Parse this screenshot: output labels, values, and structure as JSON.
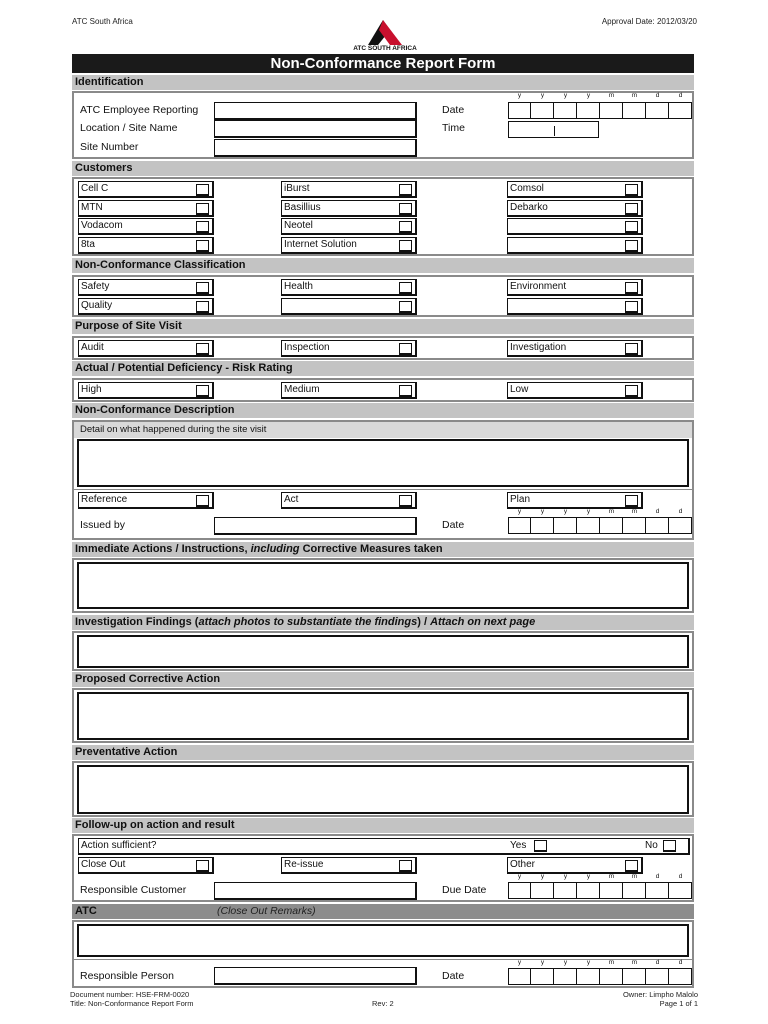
{
  "header": {
    "company": "ATC South Africa",
    "approval": "Approval Date:  2012/03/20",
    "logo_text": "ATC SOUTH AFRICA",
    "title": "Non-Conformance Report Form"
  },
  "date_labels": [
    "y",
    "y",
    "y",
    "y",
    "m",
    "m",
    "d",
    "d"
  ],
  "identification": {
    "heading": "Identification",
    "employee_label": "ATC Employee Reporting",
    "location_label": "Location / Site Name",
    "site_number_label": "Site Number",
    "date_label": "Date",
    "time_label": "Time"
  },
  "customers": {
    "heading": "Customers",
    "col1": [
      "Cell C",
      "MTN",
      "Vodacom",
      "8ta"
    ],
    "col2": [
      "iBurst",
      "Basillius",
      "Neotel",
      "Internet Solution"
    ],
    "col3": [
      "Comsol",
      "Debarko",
      "",
      ""
    ]
  },
  "classification": {
    "heading": "Non-Conformance Classification",
    "row1": [
      "Safety",
      "Health",
      "Environment"
    ],
    "row2": [
      "Quality",
      "",
      ""
    ]
  },
  "purpose": {
    "heading": "Purpose of Site Visit",
    "items": [
      "Audit",
      "Inspection",
      "Investigation"
    ]
  },
  "risk": {
    "heading": "Actual / Potential Deficiency - Risk Rating",
    "items": [
      "High",
      "Medium",
      "Low"
    ]
  },
  "description": {
    "heading": "Non-Conformance Description",
    "hint": "Detail on what happened during the site visit",
    "items": [
      "Reference",
      "Act",
      "Plan"
    ],
    "issued_by_label": "Issued by",
    "date_label": "Date"
  },
  "immediate": {
    "heading_a": "Immediate Actions / Instructions, ",
    "heading_italic": "including",
    "heading_b": " Corrective Measures taken"
  },
  "investigation": {
    "heading_a": "Investigation Findings (",
    "heading_italic": "attach photos to substantiate the findings",
    "heading_b": ") / ",
    "heading_italic2": "Attach on next page"
  },
  "proposed": {
    "heading": "Proposed Corrective Action"
  },
  "preventative": {
    "heading": "Preventative Action"
  },
  "followup": {
    "heading": "Follow-up on action and result",
    "action_sufficient": "Action sufficient?",
    "yes": "Yes",
    "no": "No",
    "items": [
      "Close Out",
      "Re-issue",
      "Other"
    ],
    "responsible_customer_label": "Responsible Customer",
    "due_date_label": "Due Date"
  },
  "atc": {
    "heading": "ATC",
    "remarks": "(Close Out Remarks)",
    "responsible_person_label": "Responsible Person",
    "date_label": "Date"
  },
  "footer": {
    "doc_number": "Document number: HSE-FRM-0020",
    "title": "Title: Non-Conformance Report Form",
    "rev": "Rev: 2",
    "owner": "Owner: Limpho Malolo",
    "page": "Page 1 of 1"
  }
}
